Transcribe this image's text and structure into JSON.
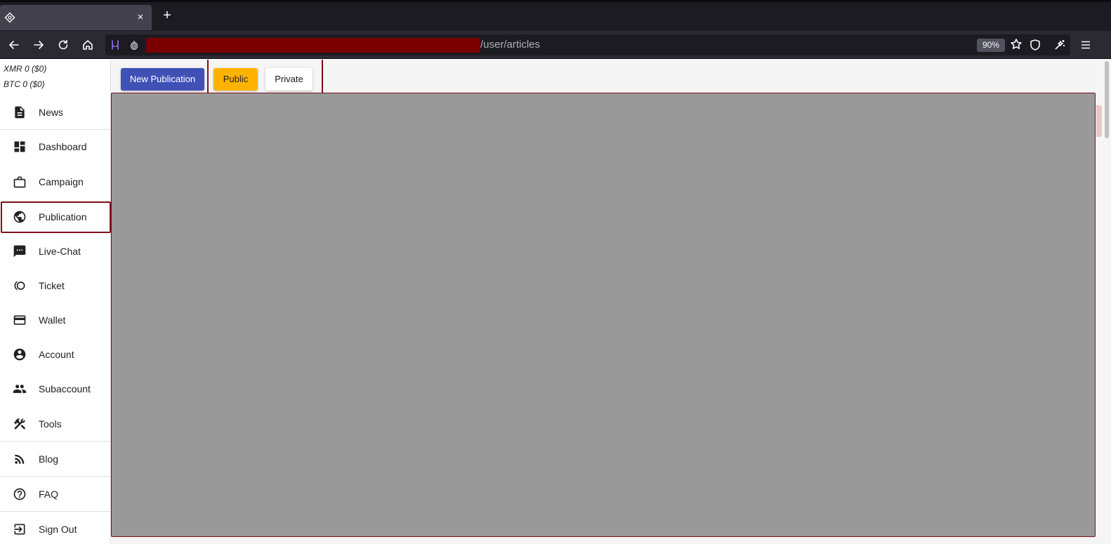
{
  "browser": {
    "tab": {
      "title": "",
      "close_glyph": "×"
    },
    "new_tab_glyph": "+",
    "url_path": "/user/articles",
    "zoom": "90%",
    "icons": [
      "back-arrow-icon",
      "forward-arrow-icon",
      "reload-icon",
      "home-icon",
      "tracking-protection-icon",
      "onion-icon",
      "bookmark-star-icon",
      "shield-icon",
      "extensions-icon",
      "menu-icon"
    ]
  },
  "sidebar": {
    "balances": [
      {
        "text": "XMR 0 ($0)"
      },
      {
        "text": "BTC 0 ($0)"
      }
    ],
    "items": [
      {
        "label": "News",
        "icon": "news-icon"
      },
      {
        "label": "Dashboard",
        "icon": "dashboard-icon"
      },
      {
        "label": "Campaign",
        "icon": "briefcase-icon"
      },
      {
        "label": "Publication",
        "icon": "globe-icon",
        "active": true
      },
      {
        "label": "Live-Chat",
        "icon": "chat-icon"
      },
      {
        "label": "Ticket",
        "icon": "ticket-icon"
      },
      {
        "label": "Wallet",
        "icon": "credit-card-icon"
      },
      {
        "label": "Account",
        "icon": "account-circle-icon"
      },
      {
        "label": "Subaccount",
        "icon": "people-icon"
      },
      {
        "label": "Tools",
        "icon": "tools-icon"
      },
      {
        "label": "Blog",
        "icon": "rss-icon"
      },
      {
        "label": "FAQ",
        "icon": "help-circle-icon"
      },
      {
        "label": "Sign Out",
        "icon": "sign-out-icon"
      }
    ]
  },
  "toolbar": {
    "new_label": "New Publication",
    "public_label": "Public",
    "private_label": "Private",
    "selected_filter": "Public"
  },
  "colors": {
    "primary": "#3f51b5",
    "accent": "#ffb300",
    "highlight": "#7d0f1a",
    "content_placeholder": "#999999"
  }
}
